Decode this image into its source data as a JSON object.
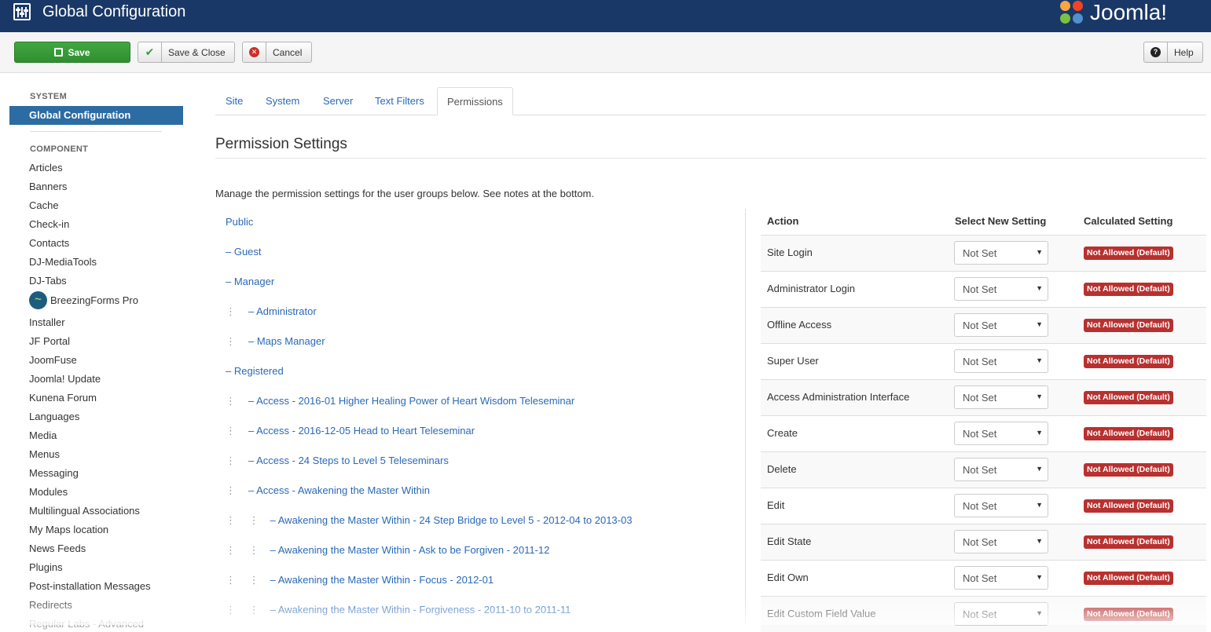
{
  "header": {
    "title": "Global Configuration",
    "brand": "Joomla!",
    "icon": "sliders-icon",
    "bg_color": "#1a3867"
  },
  "toolbar": {
    "save_label": "Save",
    "save_close_label": "Save & Close",
    "cancel_label": "Cancel",
    "help_label": "Help",
    "save_color": "#3c9e3c"
  },
  "sidebar": {
    "system_heading": "SYSTEM",
    "active_item": "Global Configuration",
    "component_heading": "COMPONENT",
    "items": [
      {
        "label": "Articles"
      },
      {
        "label": "Banners"
      },
      {
        "label": "Cache"
      },
      {
        "label": "Check-in"
      },
      {
        "label": "Contacts"
      },
      {
        "label": "DJ-MediaTools"
      },
      {
        "label": "DJ-Tabs"
      },
      {
        "label": "BreezingForms Pro",
        "icon": "breezingforms-icon"
      },
      {
        "label": "Installer"
      },
      {
        "label": "JF Portal"
      },
      {
        "label": "JoomFuse"
      },
      {
        "label": "Joomla! Update"
      },
      {
        "label": "Kunena Forum"
      },
      {
        "label": "Languages"
      },
      {
        "label": "Media"
      },
      {
        "label": "Menus"
      },
      {
        "label": "Messaging"
      },
      {
        "label": "Modules"
      },
      {
        "label": "Multilingual Associations"
      },
      {
        "label": "My Maps location"
      },
      {
        "label": "News Feeds"
      },
      {
        "label": "Plugins"
      },
      {
        "label": "Post-installation Messages"
      },
      {
        "label": "Redirects"
      },
      {
        "label": "Regular Labs - Advanced"
      }
    ]
  },
  "tabs": [
    {
      "label": "Site"
    },
    {
      "label": "System"
    },
    {
      "label": "Server"
    },
    {
      "label": "Text Filters"
    },
    {
      "label": "Permissions"
    }
  ],
  "page": {
    "title": "Permission Settings",
    "description": "Manage the permission settings for the user groups below. See notes at the bottom."
  },
  "groups": [
    {
      "label": "Public",
      "prefix": ""
    },
    {
      "label": "– Guest",
      "prefix": ""
    },
    {
      "label": "– Manager",
      "prefix": ""
    },
    {
      "label": "– Administrator",
      "prefix": "⋮"
    },
    {
      "label": "– Maps Manager",
      "prefix": "⋮"
    },
    {
      "label": "– Registered",
      "prefix": ""
    },
    {
      "label": "– Access - 2016-01 Higher Healing Power of Heart Wisdom Teleseminar",
      "prefix": "⋮"
    },
    {
      "label": "– Access - 2016-12-05 Head to Heart Teleseminar",
      "prefix": "⋮"
    },
    {
      "label": "– Access - 24 Steps to Level 5 Teleseminars",
      "prefix": "⋮"
    },
    {
      "label": "– Access - Awakening the Master Within",
      "prefix": "⋮"
    },
    {
      "label": "– Awakening the Master Within - 24 Step Bridge to Level 5 - 2012-04 to 2013-03",
      "prefix": "⋮ ⋮"
    },
    {
      "label": "– Awakening the Master Within - Ask to be Forgiven - 2011-12",
      "prefix": "⋮ ⋮"
    },
    {
      "label": "– Awakening the Master Within - Focus - 2012-01",
      "prefix": "⋮ ⋮"
    },
    {
      "label": "– Awakening the Master Within - Forgiveness - 2011-10 to 2011-11",
      "prefix": "⋮ ⋮"
    }
  ],
  "permissions": {
    "col_action": "Action",
    "col_select": "Select New Setting",
    "col_calc": "Calculated Setting",
    "badge_color": "#b8312f",
    "rows": [
      {
        "action": "Site Login",
        "setting": "Not Set",
        "calculated": "Not Allowed (Default)"
      },
      {
        "action": "Administrator Login",
        "setting": "Not Set",
        "calculated": "Not Allowed (Default)"
      },
      {
        "action": "Offline Access",
        "setting": "Not Set",
        "calculated": "Not Allowed (Default)"
      },
      {
        "action": "Super User",
        "setting": "Not Set",
        "calculated": "Not Allowed (Default)"
      },
      {
        "action": "Access Administration Interface",
        "setting": "Not Set",
        "calculated": "Not Allowed (Default)"
      },
      {
        "action": "Create",
        "setting": "Not Set",
        "calculated": "Not Allowed (Default)"
      },
      {
        "action": "Delete",
        "setting": "Not Set",
        "calculated": "Not Allowed (Default)"
      },
      {
        "action": "Edit",
        "setting": "Not Set",
        "calculated": "Not Allowed (Default)"
      },
      {
        "action": "Edit State",
        "setting": "Not Set",
        "calculated": "Not Allowed (Default)"
      },
      {
        "action": "Edit Own",
        "setting": "Not Set",
        "calculated": "Not Allowed (Default)"
      },
      {
        "action": "Edit Custom Field Value",
        "setting": "Not Set",
        "calculated": "Not Allowed (Default)"
      }
    ]
  }
}
